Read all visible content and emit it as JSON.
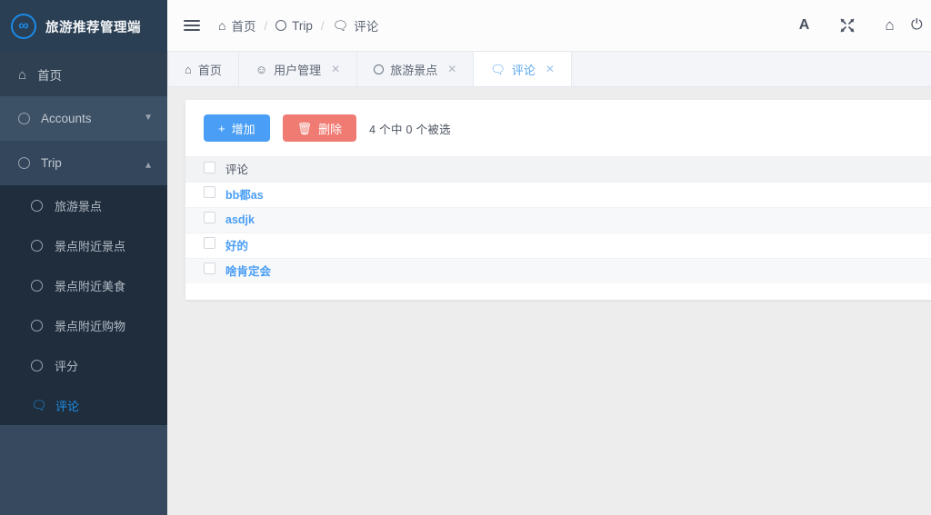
{
  "sidebar": {
    "logo": {
      "icon": "infinity-icon",
      "title": "旅游推荐管理端"
    },
    "home": {
      "icon": "home-icon",
      "label": "首页"
    },
    "groups": [
      {
        "label": "Accounts",
        "icon": "circle-icon",
        "chevron": "chevron-down-icon",
        "expanded": false
      },
      {
        "label": "Trip",
        "icon": "circle-icon",
        "chevron": "chevron-up-icon",
        "expanded": true
      }
    ],
    "sub_items": [
      {
        "label": "旅游景点",
        "icon": "circle-icon",
        "active": false
      },
      {
        "label": "景点附近景点",
        "icon": "circle-icon",
        "active": false
      },
      {
        "label": "景点附近美食",
        "icon": "circle-icon",
        "active": false
      },
      {
        "label": "景点附近购物",
        "icon": "circle-icon",
        "active": false
      },
      {
        "label": "评分",
        "icon": "circle-icon",
        "active": false
      },
      {
        "label": "评论",
        "icon": "comments-icon",
        "active": true
      }
    ]
  },
  "topbar": {
    "menu_toggle": "hamburger-icon",
    "breadcrumb": [
      {
        "icon": "home-icon",
        "label": "首页"
      },
      {
        "icon": "circle-icon",
        "label": "Trip"
      },
      {
        "icon": "comments-icon",
        "label": "评论"
      }
    ],
    "separator": "/",
    "actions": [
      {
        "name": "font-size-icon",
        "glyph": "A"
      },
      {
        "name": "fullscreen-icon",
        "glyph": "⤧"
      },
      {
        "name": "home-icon",
        "glyph": "⌂"
      },
      {
        "name": "power-icon",
        "glyph": "⏻"
      }
    ]
  },
  "tabs": [
    {
      "label": "首页",
      "icon": "home-icon",
      "closable": false,
      "active": false
    },
    {
      "label": "用户管理",
      "icon": "user-icon",
      "closable": true,
      "active": false
    },
    {
      "label": "旅游景点",
      "icon": "circle-icon",
      "closable": true,
      "active": false
    },
    {
      "label": "评论",
      "icon": "comments-icon",
      "closable": true,
      "active": true
    }
  ],
  "toolbar": {
    "add_label": "增加",
    "add_icon": "plus-icon",
    "delete_label": "删除",
    "delete_icon": "trash-icon",
    "selection_info": "4 个中 0 个被选"
  },
  "table": {
    "columns": [
      "评论"
    ],
    "rows": [
      {
        "comment": "bb都as"
      },
      {
        "comment": "asdjk"
      },
      {
        "comment": "好的"
      },
      {
        "comment": "啥肯定会"
      }
    ]
  },
  "colors": {
    "sidebar_bg": "#36495f",
    "sidebar_dark": "#1f2d3d",
    "accent_blue": "#4a9ef5",
    "danger_red": "#f07b72",
    "link_blue": "#4a9ef5",
    "page_bg": "#ededed"
  }
}
